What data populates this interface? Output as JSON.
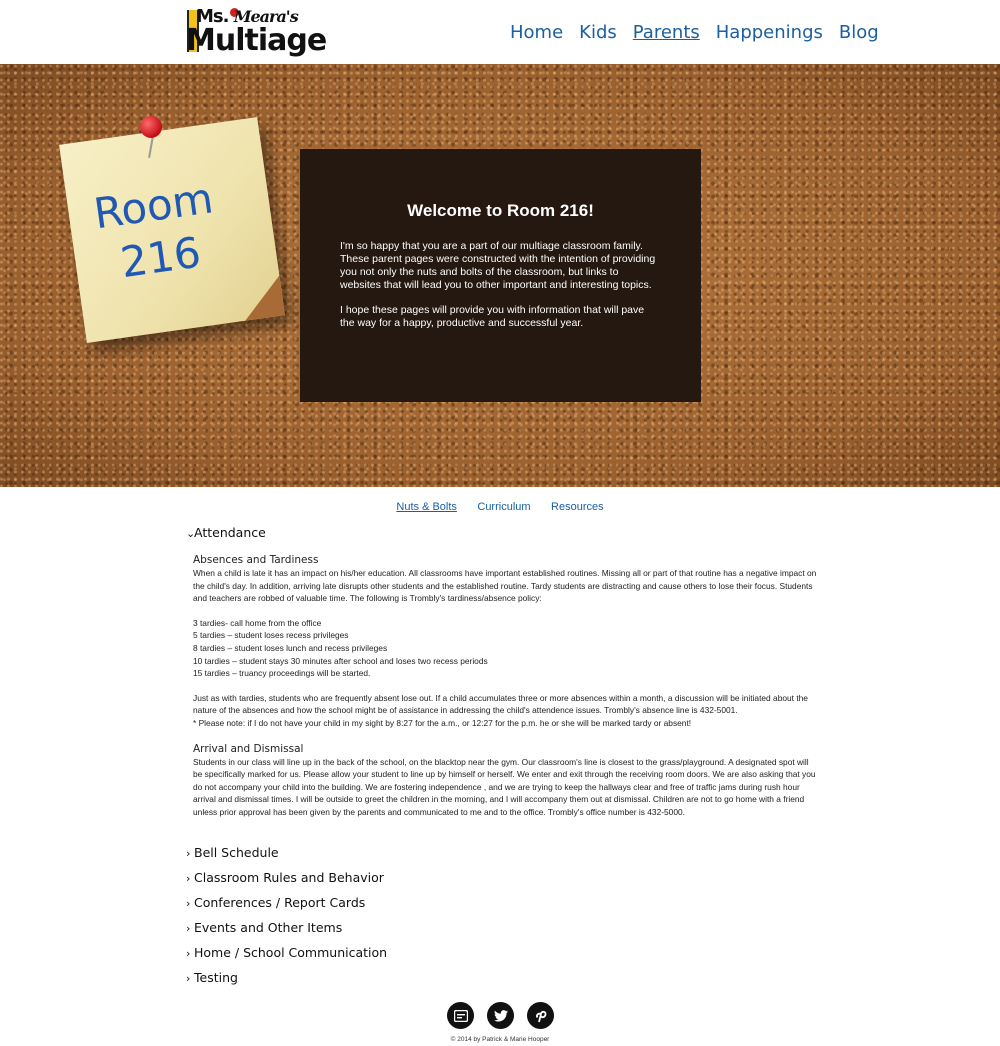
{
  "logo": {
    "line1_ms": "Ms.",
    "line1_name": "Meara's",
    "line2": "Multiage"
  },
  "nav": {
    "items": [
      {
        "label": "Home"
      },
      {
        "label": "Kids"
      },
      {
        "label": "Parents",
        "active": true
      },
      {
        "label": "Happenings"
      },
      {
        "label": "Blog"
      }
    ]
  },
  "hero": {
    "note_line1": "Room",
    "note_line2": "216",
    "welcome_title": "Welcome to Room 216!",
    "welcome_p1": "I'm so happy that you are a part of our multiage classroom family. These parent pages were constructed with the intention of providing you not only the nuts and bolts of the classroom, but links to websites that will lead you to other important and interesting topics.",
    "welcome_p2": "I hope these pages will provide you with information that will pave the way for a happy, productive and successful year."
  },
  "subnav": {
    "items": [
      {
        "label": "Nuts & Bolts",
        "active": true
      },
      {
        "label": "Curriculum"
      },
      {
        "label": "Resources"
      }
    ]
  },
  "attendance": {
    "heading": "Attendance",
    "absences_title": "Absences and Tardiness",
    "absences_body": "When a child is late it has an impact on his/her education. All classrooms have important established routines. Missing all or part of that routine has a negative impact on the child's day. In addition, arriving late disrupts other students and the established routine. Tardy students are distracting and cause others to lose their focus. Students and teachers are robbed of valuable time. The following is Trombly's tardiness/absence policy:",
    "policy": [
      "3 tardies- call home from the office",
      "5 tardies – student loses recess privileges",
      "8 tardies – student loses lunch and recess privileges",
      "10 tardies – student stays 30 minutes after school and loses two recess periods",
      "15 tardies – truancy proceedings will be started."
    ],
    "absences_note": "Just as with tardies, students who are frequently absent lose out. If a child accumulates three or more absences within a month, a discussion will be initiated about the nature of the absences and how the school might be of assistance in addressing the child's attendence issues. Trombly's absence line is 432-5001.",
    "please_note": "* Please note: if I do not have your child in my sight by 8:27 for the a.m., or 12:27 for the p.m. he or she will be marked tardy or absent!",
    "arrival_title": "Arrival and Dismissal",
    "arrival_body": "Students in our class will line up in the back of the school, on the blacktop near the gym. Our classroom's line is closest to the grass/playground. A designated spot will be specifically marked for us. Please allow your student to line up by himself or herself. We enter and exit through the receiving room doors. We are also asking that you do not accompany your child into the building. We are fostering independence , and we are trying to keep the hallways clear and free of traffic jams during rush hour arrival and dismissal times. I will be outside to greet the children in the morning, and I will accompany them out at dismissal. Children are not to go home with a friend unless prior approval has been given by the parents and communicated to me and to the office. Trombly's office number is 432-5000."
  },
  "sections": [
    {
      "label": "Bell Schedule"
    },
    {
      "label": "Classroom Rules and Behavior"
    },
    {
      "label": "Conferences / Report Cards"
    },
    {
      "label": "Events and Other Items"
    },
    {
      "label": "Home / School Communication"
    },
    {
      "label": "Testing"
    }
  ],
  "footer": {
    "icons": [
      "blog-icon",
      "twitter-icon",
      "pinterest-icon"
    ],
    "copyright": "© 2014 by Patrick & Marie Hooper"
  },
  "colors": {
    "link": "#1a5fa0",
    "welcome_bg": "#241810",
    "note_text": "#1f58b5"
  }
}
